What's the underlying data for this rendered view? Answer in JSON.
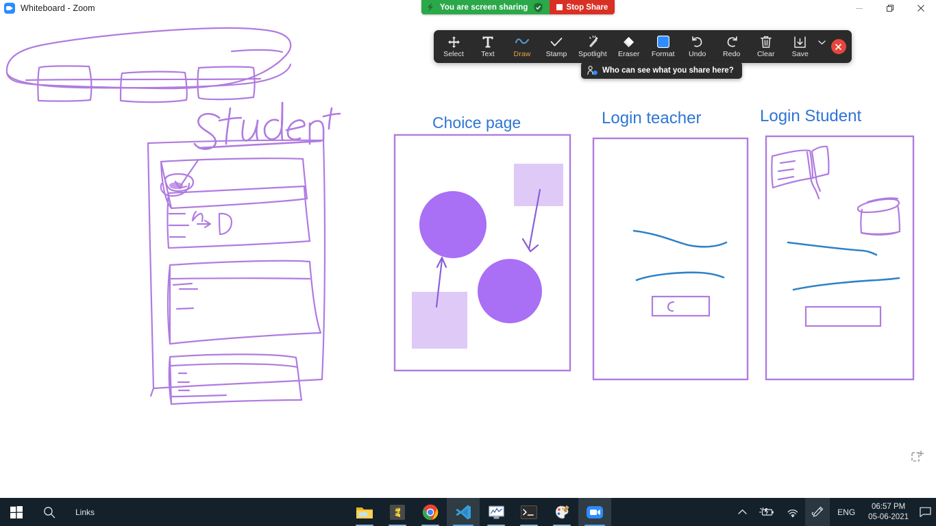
{
  "window": {
    "title": "Whiteboard - Zoom",
    "app_icon": "zoom-video-icon",
    "minimize_label": "Minimize",
    "restore_label": "Restore",
    "close_label": "Close"
  },
  "share_bar": {
    "status_text": "You are screen sharing",
    "lightning_icon": "lightning-icon",
    "shield_icon": "shield-check-icon",
    "stop_label": "Stop Share",
    "green": "#2BA84A",
    "red": "#D93025"
  },
  "toolbar": {
    "active_tool": "Draw",
    "active_color": "#E8A33D",
    "background": "#2B2B2B",
    "tools": [
      {
        "label": "Select",
        "icon": "move-arrows-icon"
      },
      {
        "label": "Text",
        "icon": "text-t-icon"
      },
      {
        "label": "Draw",
        "icon": "squiggle-draw-icon"
      },
      {
        "label": "Stamp",
        "icon": "checkmark-stamp-icon"
      },
      {
        "label": "Spotlight",
        "icon": "spotlight-wand-icon"
      },
      {
        "label": "Eraser",
        "icon": "eraser-diamond-icon"
      },
      {
        "label": "Format",
        "icon": "format-color-square-icon"
      },
      {
        "label": "Undo",
        "icon": "undo-arrow-icon"
      },
      {
        "label": "Redo",
        "icon": "redo-arrow-icon"
      },
      {
        "label": "Clear",
        "icon": "trash-can-icon"
      },
      {
        "label": "Save",
        "icon": "save-download-icon"
      }
    ],
    "save_dropdown_icon": "chevron-down-icon",
    "close_icon": "close-x-icon"
  },
  "tooltip": {
    "icon": "person-privacy-icon",
    "text": "Who can see what you share here?"
  },
  "whiteboard": {
    "pen_color": "#B07BE0",
    "pen_color_light": "#DFC9F7",
    "pen_color_solid": "#A96FF5",
    "pen_color_blue": "#2E82C8",
    "heading_color": "#2E75D4",
    "handwritten_labels": [
      {
        "text": "Student",
        "style": "handwritten-purple"
      },
      {
        "text": "N",
        "style": "handwritten-purple-small"
      },
      {
        "text": "D",
        "style": "handwritten-purple-small"
      },
      {
        "text": "C",
        "style": "handwritten-purple-small"
      }
    ],
    "panels": [
      {
        "title": "Choice page",
        "name": "choice-page-panel"
      },
      {
        "title": "Login teacher",
        "name": "login-teacher-panel"
      },
      {
        "title": "Login Student",
        "name": "login-student-panel"
      }
    ],
    "add_page_icon": "add-page-icon"
  },
  "taskbar": {
    "start_icon": "windows-start-icon",
    "search_icon": "search-magnifier-icon",
    "links_label": "Links",
    "apps": [
      {
        "name": "file-explorer",
        "icon": "folder-icon"
      },
      {
        "name": "sublime-text",
        "icon": "sublime-s-icon"
      },
      {
        "name": "google-chrome",
        "icon": "chrome-icon"
      },
      {
        "name": "vs-code",
        "icon": "vscode-icon"
      },
      {
        "name": "task-manager",
        "icon": "monitor-chart-icon"
      },
      {
        "name": "command-prompt",
        "icon": "terminal-icon"
      },
      {
        "name": "paint",
        "icon": "paint-palette-icon"
      },
      {
        "name": "zoom",
        "icon": "zoom-video-icon"
      }
    ],
    "tray": [
      {
        "name": "show-hidden-icons",
        "icon": "chevron-up-icon"
      },
      {
        "name": "battery",
        "icon": "battery-charging-icon"
      },
      {
        "name": "network",
        "icon": "wifi-icon"
      },
      {
        "name": "pen-input",
        "icon": "pen-tablet-icon"
      }
    ],
    "language": "ENG",
    "time": "06:57 PM",
    "date": "05-06-2021",
    "notification_icon": "notification-speech-icon"
  }
}
